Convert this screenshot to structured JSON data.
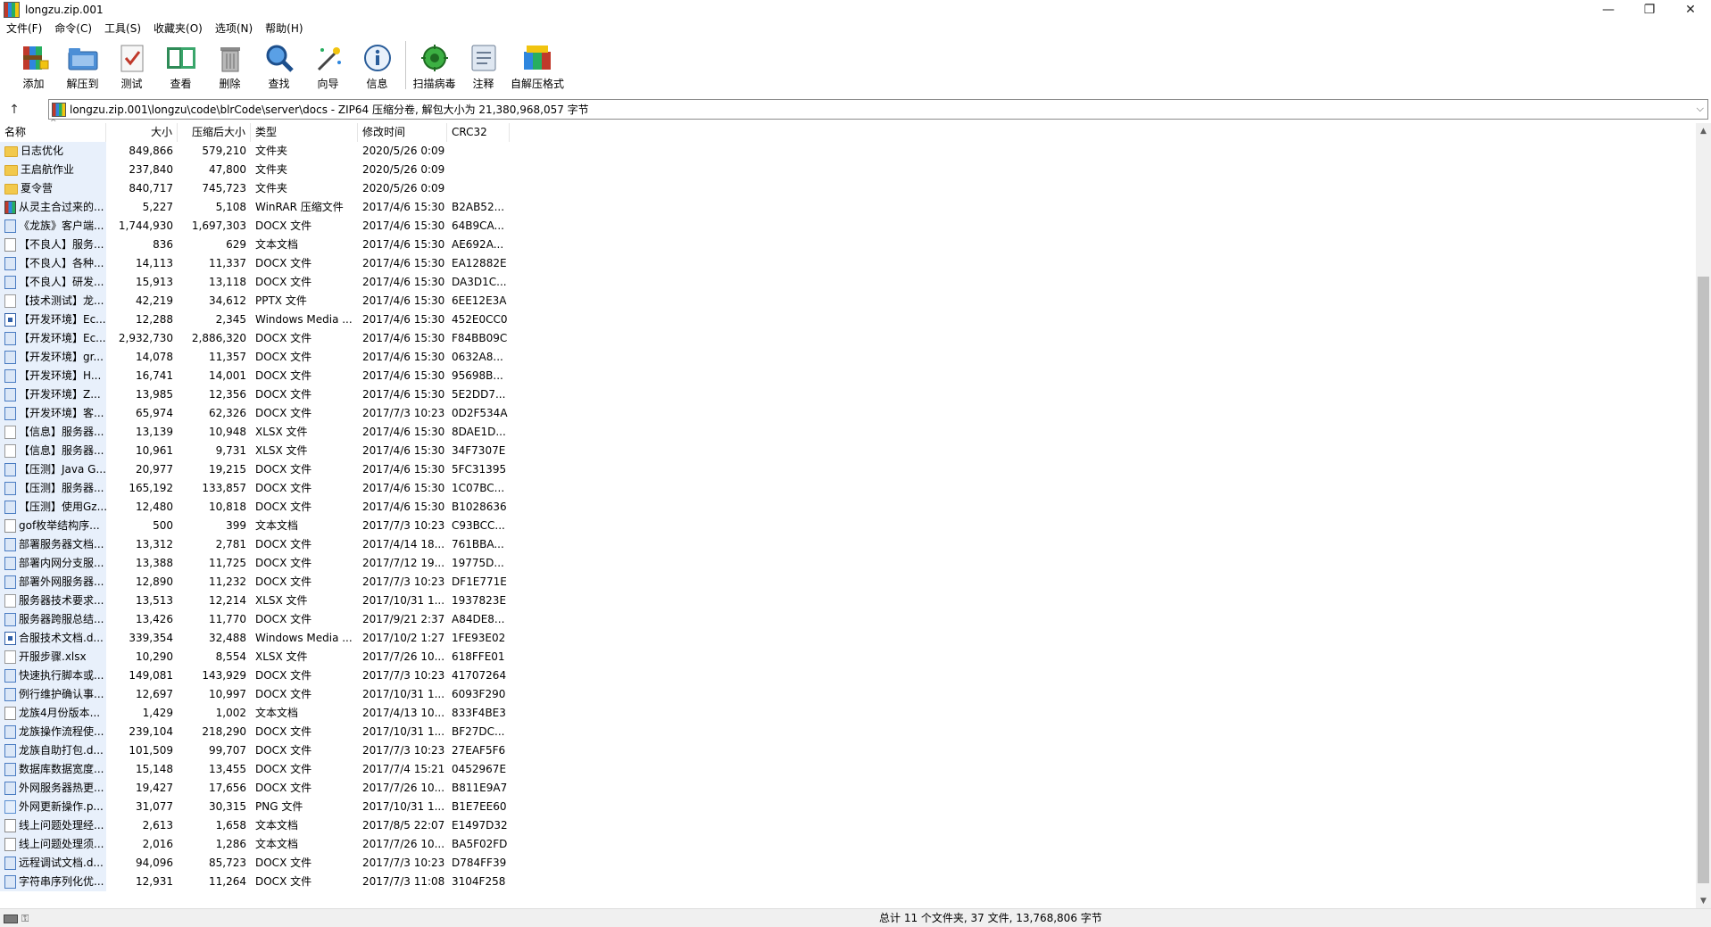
{
  "window": {
    "title": "longzu.zip.001",
    "controls": [
      "—",
      "❐",
      "✕"
    ]
  },
  "menu": [
    "文件(F)",
    "命令(C)",
    "工具(S)",
    "收藏夹(O)",
    "选项(N)",
    "帮助(H)"
  ],
  "toolbar": {
    "group1": [
      {
        "label": "添加",
        "icon": "add-archive-icon"
      },
      {
        "label": "解压到",
        "icon": "extract-to-icon"
      },
      {
        "label": "测试",
        "icon": "test-icon"
      },
      {
        "label": "查看",
        "icon": "view-book-icon"
      },
      {
        "label": "删除",
        "icon": "trash-icon"
      },
      {
        "label": "查找",
        "icon": "magnifier-icon"
      },
      {
        "label": "向导",
        "icon": "wizard-wand-icon"
      },
      {
        "label": "信息",
        "icon": "info-icon"
      }
    ],
    "group2": [
      {
        "label": "扫描病毒",
        "icon": "virus-scan-icon"
      },
      {
        "label": "注释",
        "icon": "comment-icon"
      },
      {
        "label": "自解压格式",
        "icon": "sfx-icon"
      }
    ]
  },
  "address": {
    "up_label": "↑",
    "path": "longzu.zip.001\\longzu\\code\\blrCode\\server\\docs - ZIP64 压缩分卷, 解包大小为 21,380,968,057 字节",
    "dropdown": "⌵"
  },
  "columns": {
    "name": "名称",
    "size": "大小",
    "packed": "压缩后大小",
    "type": "类型",
    "modified": "修改时间",
    "crc": "CRC32",
    "sort_arrow": "^"
  },
  "files": [
    {
      "icon": "folder",
      "name": "日志优化",
      "size": "849,866",
      "packed": "579,210",
      "type": "文件夹",
      "modified": "2020/5/26 0:09",
      "crc": ""
    },
    {
      "icon": "folder",
      "name": "王启航作业",
      "size": "237,840",
      "packed": "47,800",
      "type": "文件夹",
      "modified": "2020/5/26 0:09",
      "crc": ""
    },
    {
      "icon": "folder",
      "name": "夏令营",
      "size": "840,717",
      "packed": "745,723",
      "type": "文件夹",
      "modified": "2020/5/26 0:09",
      "crc": ""
    },
    {
      "icon": "rar",
      "name": "从灵主合过来的...",
      "size": "5,227",
      "packed": "5,108",
      "type": "WinRAR 压缩文件",
      "modified": "2017/4/6 15:30",
      "crc": "B2AB52..."
    },
    {
      "icon": "docx",
      "name": "《龙族》客户端...",
      "size": "1,744,930",
      "packed": "1,697,303",
      "type": "DOCX 文件",
      "modified": "2017/4/6 15:30",
      "crc": "64B9CA..."
    },
    {
      "icon": "txt",
      "name": "【不良人】服务...",
      "size": "836",
      "packed": "629",
      "type": "文本文档",
      "modified": "2017/4/6 15:30",
      "crc": "AE692A..."
    },
    {
      "icon": "docx",
      "name": "【不良人】各种...",
      "size": "14,113",
      "packed": "11,337",
      "type": "DOCX 文件",
      "modified": "2017/4/6 15:30",
      "crc": "EA12882E"
    },
    {
      "icon": "docx",
      "name": "【不良人】研发...",
      "size": "15,913",
      "packed": "13,118",
      "type": "DOCX 文件",
      "modified": "2017/4/6 15:30",
      "crc": "DA3D1C..."
    },
    {
      "icon": "pptx",
      "name": "【技术测试】龙...",
      "size": "42,219",
      "packed": "34,612",
      "type": "PPTX 文件",
      "modified": "2017/4/6 15:30",
      "crc": "6EE12E3A"
    },
    {
      "icon": "wmv",
      "name": "【开发环境】Ec...",
      "size": "12,288",
      "packed": "2,345",
      "type": "Windows Media ...",
      "modified": "2017/4/6 15:30",
      "crc": "452E0CC0"
    },
    {
      "icon": "docx",
      "name": "【开发环境】Ec...",
      "size": "2,932,730",
      "packed": "2,886,320",
      "type": "DOCX 文件",
      "modified": "2017/4/6 15:30",
      "crc": "F84BB09C"
    },
    {
      "icon": "docx",
      "name": "【开发环境】gr...",
      "size": "14,078",
      "packed": "11,357",
      "type": "DOCX 文件",
      "modified": "2017/4/6 15:30",
      "crc": "0632A8..."
    },
    {
      "icon": "docx",
      "name": "【开发环境】H...",
      "size": "16,741",
      "packed": "14,001",
      "type": "DOCX 文件",
      "modified": "2017/4/6 15:30",
      "crc": "95698B..."
    },
    {
      "icon": "docx",
      "name": "【开发环境】Z...",
      "size": "13,985",
      "packed": "12,356",
      "type": "DOCX 文件",
      "modified": "2017/4/6 15:30",
      "crc": "5E2DD7..."
    },
    {
      "icon": "docx",
      "name": "【开发环境】客...",
      "size": "65,974",
      "packed": "62,326",
      "type": "DOCX 文件",
      "modified": "2017/7/3 10:23",
      "crc": "0D2F534A"
    },
    {
      "icon": "xlsx",
      "name": "【信息】服务器...",
      "size": "13,139",
      "packed": "10,948",
      "type": "XLSX 文件",
      "modified": "2017/4/6 15:30",
      "crc": "8DAE1D..."
    },
    {
      "icon": "xlsx",
      "name": "【信息】服务器...",
      "size": "10,961",
      "packed": "9,731",
      "type": "XLSX 文件",
      "modified": "2017/4/6 15:30",
      "crc": "34F7307E"
    },
    {
      "icon": "docx",
      "name": "【压测】Java G...",
      "size": "20,977",
      "packed": "19,215",
      "type": "DOCX 文件",
      "modified": "2017/4/6 15:30",
      "crc": "5FC31395"
    },
    {
      "icon": "docx",
      "name": "【压测】服务器...",
      "size": "165,192",
      "packed": "133,857",
      "type": "DOCX 文件",
      "modified": "2017/4/6 15:30",
      "crc": "1C07BC..."
    },
    {
      "icon": "docx",
      "name": "【压测】使用Gz...",
      "size": "12,480",
      "packed": "10,818",
      "type": "DOCX 文件",
      "modified": "2017/4/6 15:30",
      "crc": "B1028636"
    },
    {
      "icon": "txt",
      "name": "gof枚举结构序...",
      "size": "500",
      "packed": "399",
      "type": "文本文档",
      "modified": "2017/7/3 10:23",
      "crc": "C93BCC..."
    },
    {
      "icon": "docx",
      "name": "部署服务器文档...",
      "size": "13,312",
      "packed": "2,781",
      "type": "DOCX 文件",
      "modified": "2017/4/14 18...",
      "crc": "761BBA..."
    },
    {
      "icon": "docx",
      "name": "部署内网分支服...",
      "size": "13,388",
      "packed": "11,725",
      "type": "DOCX 文件",
      "modified": "2017/7/12 19...",
      "crc": "19775D..."
    },
    {
      "icon": "docx",
      "name": "部署外网服务器...",
      "size": "12,890",
      "packed": "11,232",
      "type": "DOCX 文件",
      "modified": "2017/7/3 10:23",
      "crc": "DF1E771E"
    },
    {
      "icon": "xlsx",
      "name": "服务器技术要求...",
      "size": "13,513",
      "packed": "12,214",
      "type": "XLSX 文件",
      "modified": "2017/10/31 1...",
      "crc": "1937823E"
    },
    {
      "icon": "docx",
      "name": "服务器跨服总结...",
      "size": "13,426",
      "packed": "11,770",
      "type": "DOCX 文件",
      "modified": "2017/9/21 2:37",
      "crc": "A84DE8..."
    },
    {
      "icon": "wmv",
      "name": "合服技术文档.d...",
      "size": "339,354",
      "packed": "32,488",
      "type": "Windows Media ...",
      "modified": "2017/10/2 1:27",
      "crc": "1FE93E02"
    },
    {
      "icon": "xlsx",
      "name": "开服步骤.xlsx",
      "size": "10,290",
      "packed": "8,554",
      "type": "XLSX 文件",
      "modified": "2017/7/26 10...",
      "crc": "618FFE01"
    },
    {
      "icon": "docx",
      "name": "快速执行脚本或...",
      "size": "149,081",
      "packed": "143,929",
      "type": "DOCX 文件",
      "modified": "2017/7/3 10:23",
      "crc": "41707264"
    },
    {
      "icon": "docx",
      "name": "例行维护确认事...",
      "size": "12,697",
      "packed": "10,997",
      "type": "DOCX 文件",
      "modified": "2017/10/31 1...",
      "crc": "6093F290"
    },
    {
      "icon": "txt",
      "name": "龙族4月份版本...",
      "size": "1,429",
      "packed": "1,002",
      "type": "文本文档",
      "modified": "2017/4/13 10...",
      "crc": "833F4BE3"
    },
    {
      "icon": "docx",
      "name": "龙族操作流程使...",
      "size": "239,104",
      "packed": "218,290",
      "type": "DOCX 文件",
      "modified": "2017/10/31 1...",
      "crc": "BF27DC..."
    },
    {
      "icon": "docx",
      "name": "龙族自助打包.d...",
      "size": "101,509",
      "packed": "99,707",
      "type": "DOCX 文件",
      "modified": "2017/7/3 10:23",
      "crc": "27EAF5F6"
    },
    {
      "icon": "docx",
      "name": "数据库数据宽度...",
      "size": "15,148",
      "packed": "13,455",
      "type": "DOCX 文件",
      "modified": "2017/7/4 15:21",
      "crc": "0452967E"
    },
    {
      "icon": "docx",
      "name": "外网服务器热更...",
      "size": "19,427",
      "packed": "17,656",
      "type": "DOCX 文件",
      "modified": "2017/7/26 10...",
      "crc": "B811E9A7"
    },
    {
      "icon": "png",
      "name": "外网更新操作.p...",
      "size": "31,077",
      "packed": "30,315",
      "type": "PNG 文件",
      "modified": "2017/10/31 1...",
      "crc": "B1E7EE60"
    },
    {
      "icon": "txt",
      "name": "线上问题处理经...",
      "size": "2,613",
      "packed": "1,658",
      "type": "文本文档",
      "modified": "2017/8/5 22:07",
      "crc": "E1497D32"
    },
    {
      "icon": "txt",
      "name": "线上问题处理须...",
      "size": "2,016",
      "packed": "1,286",
      "type": "文本文档",
      "modified": "2017/7/26 10...",
      "crc": "BA5F02FD"
    },
    {
      "icon": "docx",
      "name": "远程调试文档.d...",
      "size": "94,096",
      "packed": "85,723",
      "type": "DOCX 文件",
      "modified": "2017/7/3 10:23",
      "crc": "D784FF39"
    },
    {
      "icon": "docx",
      "name": "字符串序列化优...",
      "size": "12,931",
      "packed": "11,264",
      "type": "DOCX 文件",
      "modified": "2017/7/3 11:08",
      "crc": "3104F258"
    }
  ],
  "statusbar": {
    "summary": "总计 11 个文件夹, 37 文件, 13,768,806 字节",
    "key_glyph": "⚿"
  },
  "scrollbar": {
    "up": "▲",
    "down": "▼"
  }
}
